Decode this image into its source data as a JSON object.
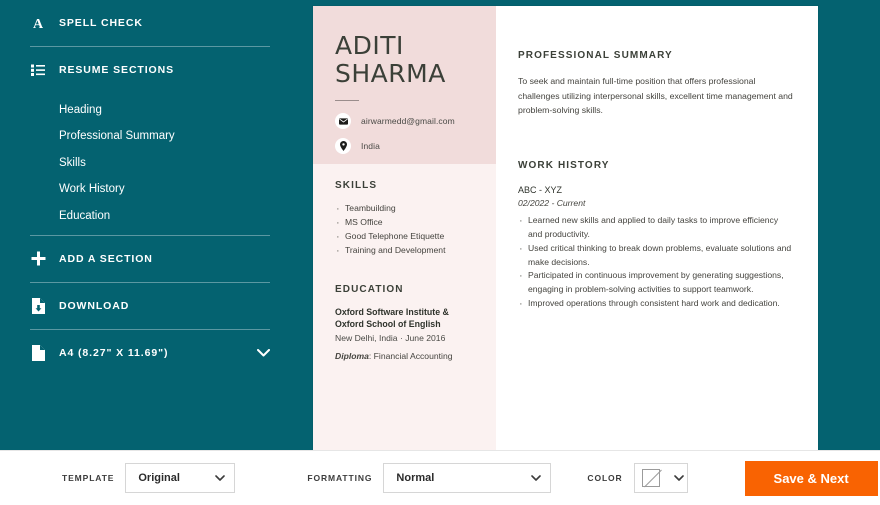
{
  "sidebar": {
    "spell_check": {
      "label": "SPELL CHECK",
      "icon": "letter-a-icon"
    },
    "resume_sections": {
      "label": "RESUME SECTIONS",
      "icon": "list-icon"
    },
    "sections": [
      {
        "label": "Heading"
      },
      {
        "label": "Professional Summary"
      },
      {
        "label": "Skills"
      },
      {
        "label": "Work History"
      },
      {
        "label": "Education"
      }
    ],
    "add_section": {
      "label": "ADD A SECTION",
      "icon": "plus-icon"
    },
    "download": {
      "label": "DOWNLOAD",
      "icon": "download-document-icon"
    },
    "paper_size": {
      "label": "A4 (8.27\" X 11.69\")",
      "icon": "document-icon",
      "caret": "chevron-down-icon"
    }
  },
  "resume": {
    "name_line1": "ADITI",
    "name_line2": "SHARMA",
    "contacts": [
      {
        "icon": "envelope-icon",
        "text": "airwarmedd@gmail.com"
      },
      {
        "icon": "location-pin-icon",
        "text": "India"
      }
    ],
    "skills": {
      "title": "SKILLS",
      "items": [
        "Teambuilding",
        "MS Office",
        "Good Telephone Etiquette",
        "Training and Development"
      ]
    },
    "education": {
      "title": "EDUCATION",
      "school": "Oxford Software Institute & Oxford School of English",
      "meta": "New Delhi, India · June 2016",
      "degree_label": "Diploma",
      "degree_value": ": Financial Accounting"
    },
    "professional_summary": {
      "title": "PROFESSIONAL SUMMARY",
      "text": "To seek and maintain full-time position that offers professional challenges utilizing interpersonal skills, excellent time management and problem-solving skills."
    },
    "work_history": {
      "title": "WORK HISTORY",
      "company": "ABC - XYZ",
      "dates": "02/2022 - Current",
      "bullets": [
        "Learned new skills and applied to daily tasks to improve efficiency and productivity.",
        "Used critical thinking to break down problems, evaluate solutions and make decisions.",
        "Participated in continuous improvement by generating suggestions, engaging in problem-solving activities to support teamwork.",
        "Improved operations through consistent hard work and dedication."
      ]
    }
  },
  "footer": {
    "template_label": "TEMPLATE",
    "template_value": "Original",
    "formatting_label": "FORMATTING",
    "formatting_value": "Normal",
    "color_label": "COLOR",
    "color_value": "none",
    "save_button": "Save & Next"
  },
  "colors": {
    "sidebar_bg": "#046270",
    "accent_orange": "#f96302",
    "resume_header_pink": "#f1dcdb",
    "resume_left_pink": "#fbf2f1"
  }
}
